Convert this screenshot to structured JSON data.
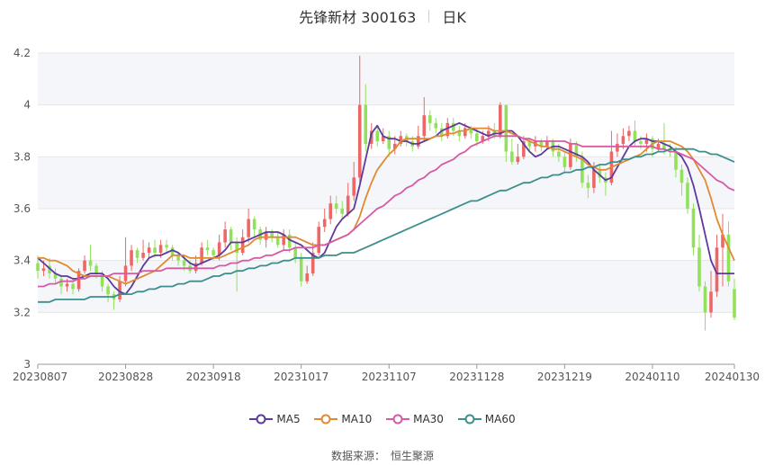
{
  "header": {
    "title": "先锋新材 300163",
    "period": "日K"
  },
  "source": {
    "label": "数据来源：",
    "value": "恒生聚源"
  },
  "colors": {
    "up": "#ee6666",
    "down": "#91e25a",
    "ma5": "#5d3a9b",
    "ma10": "#e08a35",
    "ma30": "#d65aa5",
    "ma60": "#3d8f8f",
    "grid": "#e6e6e6",
    "band": "#f5f6fa"
  },
  "chart_data": {
    "type": "candlestick",
    "title": "先锋新材 300163",
    "ylim": [
      3,
      4.2
    ],
    "yticks": [
      "3",
      "3.2",
      "3.4",
      "3.6",
      "3.8",
      "4",
      "4.2"
    ],
    "xticks": [
      {
        "index": 0,
        "label": "20230807"
      },
      {
        "index": 15,
        "label": "20230828"
      },
      {
        "index": 30,
        "label": "20230918"
      },
      {
        "index": 45,
        "label": "20231017"
      },
      {
        "index": 60,
        "label": "20231107"
      },
      {
        "index": 75,
        "label": "20231128"
      },
      {
        "index": 90,
        "label": "20231219"
      },
      {
        "index": 105,
        "label": "20240110"
      },
      {
        "index": 119,
        "label": "20240130"
      }
    ],
    "candles": [
      [
        3.39,
        3.36,
        3.33,
        3.42
      ],
      [
        3.36,
        3.37,
        3.34,
        3.4
      ],
      [
        3.38,
        3.35,
        3.33,
        3.41
      ],
      [
        3.35,
        3.33,
        3.31,
        3.37
      ],
      [
        3.33,
        3.3,
        3.27,
        3.34
      ],
      [
        3.3,
        3.31,
        3.28,
        3.33
      ],
      [
        3.31,
        3.29,
        3.27,
        3.33
      ],
      [
        3.29,
        3.36,
        3.28,
        3.37
      ],
      [
        3.36,
        3.4,
        3.35,
        3.42
      ],
      [
        3.4,
        3.38,
        3.36,
        3.46
      ],
      [
        3.38,
        3.35,
        3.33,
        3.39
      ],
      [
        3.35,
        3.3,
        3.28,
        3.36
      ],
      [
        3.3,
        3.27,
        3.24,
        3.31
      ],
      [
        3.27,
        3.25,
        3.21,
        3.28
      ],
      [
        3.25,
        3.32,
        3.24,
        3.34
      ],
      [
        3.32,
        3.38,
        3.3,
        3.49
      ],
      [
        3.38,
        3.44,
        3.36,
        3.46
      ],
      [
        3.44,
        3.41,
        3.39,
        3.45
      ],
      [
        3.41,
        3.43,
        3.4,
        3.48
      ],
      [
        3.43,
        3.45,
        3.41,
        3.47
      ],
      [
        3.45,
        3.43,
        3.41,
        3.48
      ],
      [
        3.43,
        3.46,
        3.41,
        3.48
      ],
      [
        3.46,
        3.45,
        3.43,
        3.48
      ],
      [
        3.45,
        3.42,
        3.4,
        3.46
      ],
      [
        3.42,
        3.4,
        3.38,
        3.43
      ],
      [
        3.4,
        3.38,
        3.36,
        3.42
      ],
      [
        3.38,
        3.36,
        3.35,
        3.4
      ],
      [
        3.36,
        3.39,
        3.35,
        3.42
      ],
      [
        3.39,
        3.45,
        3.38,
        3.47
      ],
      [
        3.45,
        3.44,
        3.42,
        3.48
      ],
      [
        3.44,
        3.42,
        3.4,
        3.45
      ],
      [
        3.42,
        3.47,
        3.4,
        3.5
      ],
      [
        3.47,
        3.52,
        3.45,
        3.55
      ],
      [
        3.52,
        3.47,
        3.44,
        3.53
      ],
      [
        3.47,
        3.43,
        3.28,
        3.49
      ],
      [
        3.43,
        3.49,
        3.42,
        3.52
      ],
      [
        3.49,
        3.56,
        3.47,
        3.6
      ],
      [
        3.56,
        3.52,
        3.49,
        3.57
      ],
      [
        3.52,
        3.48,
        3.46,
        3.53
      ],
      [
        3.48,
        3.51,
        3.45,
        3.53
      ],
      [
        3.51,
        3.49,
        3.47,
        3.52
      ],
      [
        3.49,
        3.46,
        3.45,
        3.51
      ],
      [
        3.46,
        3.5,
        3.44,
        3.52
      ],
      [
        3.5,
        3.45,
        3.43,
        3.52
      ],
      [
        3.45,
        3.41,
        3.39,
        3.47
      ],
      [
        3.41,
        3.32,
        3.3,
        3.43
      ],
      [
        3.32,
        3.35,
        3.31,
        3.38
      ],
      [
        3.35,
        3.43,
        3.34,
        3.47
      ],
      [
        3.43,
        3.53,
        3.42,
        3.55
      ],
      [
        3.53,
        3.56,
        3.51,
        3.6
      ],
      [
        3.56,
        3.62,
        3.54,
        3.65
      ],
      [
        3.62,
        3.6,
        3.58,
        3.65
      ],
      [
        3.6,
        3.58,
        3.56,
        3.63
      ],
      [
        3.58,
        3.65,
        3.57,
        3.7
      ],
      [
        3.65,
        3.72,
        3.63,
        3.78
      ],
      [
        3.72,
        4.0,
        3.7,
        4.19
      ],
      [
        4.0,
        3.85,
        3.82,
        4.08
      ],
      [
        3.85,
        3.9,
        3.83,
        3.93
      ],
      [
        3.9,
        3.86,
        3.84,
        3.92
      ],
      [
        3.86,
        3.88,
        3.85,
        3.91
      ],
      [
        3.88,
        3.83,
        3.8,
        3.9
      ],
      [
        3.83,
        3.85,
        3.81,
        3.88
      ],
      [
        3.85,
        3.88,
        3.84,
        3.9
      ],
      [
        3.88,
        3.86,
        3.84,
        3.89
      ],
      [
        3.86,
        3.84,
        3.82,
        3.88
      ],
      [
        3.84,
        3.88,
        3.83,
        3.92
      ],
      [
        3.88,
        3.96,
        3.86,
        4.03
      ],
      [
        3.96,
        3.93,
        3.9,
        3.98
      ],
      [
        3.93,
        3.91,
        3.89,
        3.95
      ],
      [
        3.91,
        3.88,
        3.86,
        3.93
      ],
      [
        3.88,
        3.93,
        3.87,
        3.95
      ],
      [
        3.93,
        3.9,
        3.88,
        3.95
      ],
      [
        3.9,
        3.88,
        3.86,
        3.92
      ],
      [
        3.88,
        3.91,
        3.87,
        3.93
      ],
      [
        3.91,
        3.89,
        3.87,
        3.92
      ],
      [
        3.89,
        3.86,
        3.84,
        3.91
      ],
      [
        3.86,
        3.88,
        3.85,
        3.9
      ],
      [
        3.88,
        3.9,
        3.86,
        3.92
      ],
      [
        3.9,
        3.88,
        3.87,
        3.93
      ],
      [
        3.88,
        4.0,
        3.87,
        4.01
      ],
      [
        4.0,
        3.82,
        3.78,
        3.97
      ],
      [
        3.82,
        3.78,
        3.77,
        3.87
      ],
      [
        3.78,
        3.8,
        3.77,
        3.85
      ],
      [
        3.8,
        3.86,
        3.79,
        3.88
      ],
      [
        3.86,
        3.84,
        3.82,
        3.87
      ],
      [
        3.84,
        3.86,
        3.82,
        3.88
      ],
      [
        3.86,
        3.84,
        3.82,
        3.87
      ],
      [
        3.84,
        3.86,
        3.83,
        3.88
      ],
      [
        3.86,
        3.82,
        3.8,
        3.87
      ],
      [
        3.82,
        3.8,
        3.78,
        3.85
      ],
      [
        3.8,
        3.76,
        3.74,
        3.82
      ],
      [
        3.76,
        3.85,
        3.75,
        3.87
      ],
      [
        3.85,
        3.8,
        3.78,
        3.86
      ],
      [
        3.8,
        3.7,
        3.68,
        3.82
      ],
      [
        3.7,
        3.68,
        3.64,
        3.73
      ],
      [
        3.68,
        3.75,
        3.66,
        3.78
      ],
      [
        3.75,
        3.72,
        3.7,
        3.77
      ],
      [
        3.72,
        3.7,
        3.65,
        3.74
      ],
      [
        3.7,
        3.82,
        3.69,
        3.9
      ],
      [
        3.82,
        3.85,
        3.8,
        3.89
      ],
      [
        3.85,
        3.88,
        3.83,
        3.91
      ],
      [
        3.88,
        3.9,
        3.86,
        3.92
      ],
      [
        3.9,
        3.86,
        3.84,
        3.94
      ],
      [
        3.86,
        3.85,
        3.83,
        3.88
      ],
      [
        3.85,
        3.87,
        3.82,
        3.89
      ],
      [
        3.87,
        3.83,
        3.8,
        3.88
      ],
      [
        3.83,
        3.85,
        3.82,
        3.87
      ],
      [
        3.85,
        3.83,
        3.81,
        3.93
      ],
      [
        3.83,
        3.82,
        3.8,
        3.85
      ],
      [
        3.82,
        3.75,
        3.72,
        3.84
      ],
      [
        3.75,
        3.7,
        3.65,
        3.77
      ],
      [
        3.7,
        3.6,
        3.58,
        3.72
      ],
      [
        3.6,
        3.45,
        3.42,
        3.62
      ],
      [
        3.45,
        3.3,
        3.28,
        3.5
      ],
      [
        3.3,
        3.2,
        3.13,
        3.32
      ],
      [
        3.2,
        3.28,
        3.18,
        3.36
      ],
      [
        3.28,
        3.45,
        3.26,
        3.5
      ],
      [
        3.45,
        3.5,
        3.3,
        3.58
      ],
      [
        3.5,
        3.32,
        3.3,
        3.55
      ],
      [
        3.29,
        3.18,
        3.17,
        3.33
      ]
    ],
    "series": [
      {
        "name": "MA5",
        "values": [
          3.41,
          3.39,
          3.37,
          3.35,
          3.34,
          3.34,
          3.33,
          3.33,
          3.34,
          3.35,
          3.35,
          3.35,
          3.33,
          3.3,
          3.28,
          3.27,
          3.3,
          3.34,
          3.38,
          3.41,
          3.42,
          3.42,
          3.43,
          3.44,
          3.43,
          3.41,
          3.39,
          3.38,
          3.39,
          3.4,
          3.41,
          3.42,
          3.44,
          3.47,
          3.47,
          3.47,
          3.48,
          3.49,
          3.5,
          3.51,
          3.51,
          3.51,
          3.5,
          3.48,
          3.47,
          3.46,
          3.44,
          3.42,
          3.41,
          3.43,
          3.48,
          3.53,
          3.56,
          3.58,
          3.6,
          3.69,
          3.79,
          3.89,
          3.92,
          3.88,
          3.87,
          3.87,
          3.86,
          3.86,
          3.85,
          3.85,
          3.86,
          3.87,
          3.88,
          3.9,
          3.91,
          3.92,
          3.93,
          3.92,
          3.91,
          3.9,
          3.89,
          3.88,
          3.89,
          3.89,
          3.9,
          3.9,
          3.88,
          3.85,
          3.82,
          3.8,
          3.81,
          3.83,
          3.84,
          3.84,
          3.83,
          3.82,
          3.81,
          3.8,
          3.78,
          3.75,
          3.73,
          3.71,
          3.72,
          3.76,
          3.8,
          3.84,
          3.86,
          3.87,
          3.87,
          3.86,
          3.86,
          3.85,
          3.84,
          3.82,
          3.8,
          3.76,
          3.69,
          3.6,
          3.5,
          3.4,
          3.35,
          3.35,
          3.35,
          3.35
        ]
      },
      {
        "name": "MA10",
        "values": [
          3.41,
          3.41,
          3.4,
          3.4,
          3.39,
          3.38,
          3.36,
          3.35,
          3.34,
          3.34,
          3.34,
          3.34,
          3.34,
          3.33,
          3.32,
          3.31,
          3.32,
          3.33,
          3.34,
          3.35,
          3.36,
          3.38,
          3.4,
          3.42,
          3.42,
          3.42,
          3.41,
          3.41,
          3.41,
          3.41,
          3.41,
          3.41,
          3.42,
          3.43,
          3.44,
          3.45,
          3.46,
          3.48,
          3.49,
          3.49,
          3.49,
          3.49,
          3.49,
          3.49,
          3.49,
          3.48,
          3.47,
          3.46,
          3.46,
          3.46,
          3.47,
          3.48,
          3.49,
          3.5,
          3.52,
          3.57,
          3.64,
          3.7,
          3.75,
          3.78,
          3.81,
          3.83,
          3.86,
          3.87,
          3.87,
          3.87,
          3.87,
          3.87,
          3.88,
          3.88,
          3.89,
          3.89,
          3.9,
          3.9,
          3.91,
          3.91,
          3.91,
          3.91,
          3.9,
          3.9,
          3.9,
          3.89,
          3.88,
          3.87,
          3.86,
          3.85,
          3.84,
          3.84,
          3.83,
          3.83,
          3.82,
          3.81,
          3.8,
          3.79,
          3.77,
          3.76,
          3.75,
          3.75,
          3.76,
          3.77,
          3.78,
          3.79,
          3.8,
          3.81,
          3.83,
          3.85,
          3.86,
          3.86,
          3.86,
          3.85,
          3.84,
          3.82,
          3.79,
          3.75,
          3.71,
          3.64,
          3.56,
          3.5,
          3.45,
          3.4
        ]
      },
      {
        "name": "MA30",
        "values": [
          3.3,
          3.3,
          3.31,
          3.31,
          3.32,
          3.32,
          3.32,
          3.33,
          3.33,
          3.34,
          3.34,
          3.34,
          3.34,
          3.35,
          3.35,
          3.35,
          3.35,
          3.35,
          3.36,
          3.36,
          3.36,
          3.36,
          3.37,
          3.37,
          3.37,
          3.37,
          3.37,
          3.37,
          3.37,
          3.37,
          3.37,
          3.38,
          3.38,
          3.39,
          3.39,
          3.4,
          3.4,
          3.41,
          3.41,
          3.42,
          3.42,
          3.43,
          3.44,
          3.44,
          3.45,
          3.45,
          3.45,
          3.45,
          3.46,
          3.46,
          3.47,
          3.48,
          3.49,
          3.5,
          3.52,
          3.54,
          3.56,
          3.58,
          3.6,
          3.61,
          3.63,
          3.65,
          3.66,
          3.68,
          3.69,
          3.71,
          3.72,
          3.74,
          3.75,
          3.77,
          3.78,
          3.79,
          3.81,
          3.82,
          3.84,
          3.85,
          3.86,
          3.87,
          3.88,
          3.88,
          3.88,
          3.88,
          3.88,
          3.87,
          3.87,
          3.86,
          3.86,
          3.86,
          3.86,
          3.86,
          3.86,
          3.85,
          3.85,
          3.84,
          3.84,
          3.84,
          3.84,
          3.84,
          3.84,
          3.84,
          3.84,
          3.84,
          3.84,
          3.84,
          3.84,
          3.84,
          3.83,
          3.83,
          3.82,
          3.82,
          3.81,
          3.8,
          3.79,
          3.77,
          3.75,
          3.73,
          3.71,
          3.7,
          3.68,
          3.67
        ]
      },
      {
        "name": "MA60",
        "values": [
          3.24,
          3.24,
          3.24,
          3.25,
          3.25,
          3.25,
          3.25,
          3.25,
          3.25,
          3.26,
          3.26,
          3.26,
          3.26,
          3.26,
          3.27,
          3.27,
          3.27,
          3.28,
          3.28,
          3.29,
          3.29,
          3.3,
          3.3,
          3.3,
          3.31,
          3.31,
          3.32,
          3.32,
          3.32,
          3.33,
          3.34,
          3.34,
          3.35,
          3.35,
          3.36,
          3.36,
          3.37,
          3.37,
          3.38,
          3.38,
          3.39,
          3.39,
          3.4,
          3.4,
          3.41,
          3.41,
          3.41,
          3.41,
          3.41,
          3.42,
          3.42,
          3.42,
          3.43,
          3.43,
          3.43,
          3.44,
          3.45,
          3.46,
          3.47,
          3.48,
          3.49,
          3.5,
          3.51,
          3.52,
          3.53,
          3.54,
          3.55,
          3.56,
          3.57,
          3.58,
          3.59,
          3.6,
          3.61,
          3.62,
          3.63,
          3.63,
          3.64,
          3.65,
          3.66,
          3.67,
          3.67,
          3.68,
          3.69,
          3.7,
          3.7,
          3.71,
          3.72,
          3.72,
          3.73,
          3.73,
          3.74,
          3.74,
          3.75,
          3.75,
          3.76,
          3.76,
          3.77,
          3.77,
          3.78,
          3.78,
          3.79,
          3.79,
          3.8,
          3.8,
          3.81,
          3.81,
          3.82,
          3.82,
          3.83,
          3.83,
          3.83,
          3.83,
          3.83,
          3.82,
          3.82,
          3.81,
          3.81,
          3.8,
          3.79,
          3.78
        ]
      }
    ]
  }
}
